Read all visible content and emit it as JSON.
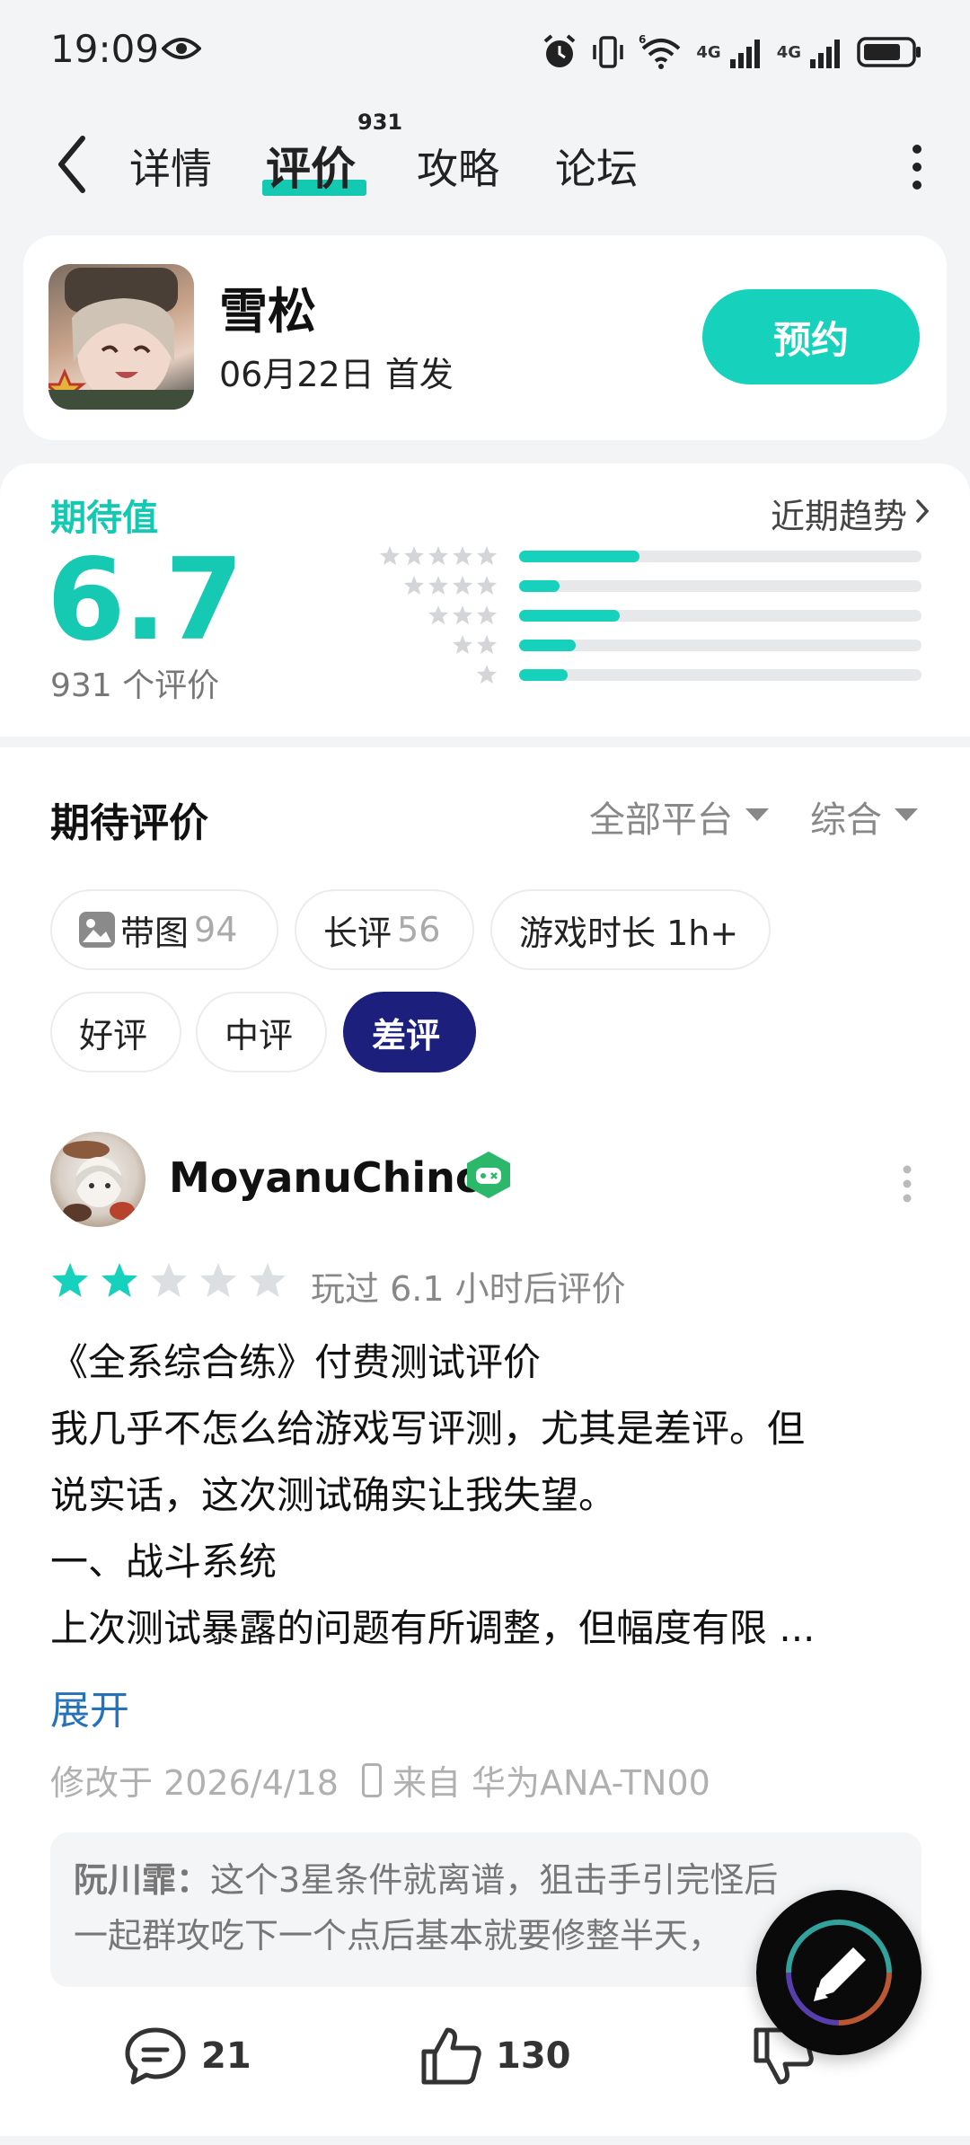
{
  "status_bar": {
    "time": "19:09",
    "net1": "4G",
    "net2": "4G",
    "wifi_badge": "6"
  },
  "nav": {
    "tabs": [
      {
        "label": "详情"
      },
      {
        "label": "评价",
        "badge": "931"
      },
      {
        "label": "攻略"
      },
      {
        "label": "论坛"
      }
    ],
    "active_tab": "评价"
  },
  "game": {
    "name": "雪松",
    "release": "06月22日 首发",
    "action_label": "预约",
    "accent_color": "#16d1bb"
  },
  "rating": {
    "label": "期待值",
    "score": "6.7",
    "count_text": "931 个评价",
    "trend_label": "近期趋势",
    "distribution": [
      {
        "stars": 5,
        "fraction": 0.3
      },
      {
        "stars": 4,
        "fraction": 0.1
      },
      {
        "stars": 3,
        "fraction": 0.25
      },
      {
        "stars": 2,
        "fraction": 0.14
      },
      {
        "stars": 1,
        "fraction": 0.12
      }
    ]
  },
  "reviews": {
    "title": "期待评价",
    "filters": {
      "platform": "全部平台",
      "sort": "综合"
    },
    "chips": [
      {
        "label": "带图",
        "count": "94"
      },
      {
        "label": "长评",
        "count": "56"
      },
      {
        "label": "游戏时长 1h+"
      },
      {
        "label": "好评"
      },
      {
        "label": "中评"
      },
      {
        "label": "差评"
      }
    ],
    "active_chip": "差评",
    "item": {
      "username": "MoyanuChino",
      "rating": 2,
      "play_time": "玩过 6.1 小时后评价",
      "text_lines": [
        "《全系综合练》付费测试评价",
        "我几乎不怎么给游戏写评测，尤其是差评。但",
        "说实话，这次测试确实让我失望。",
        "一、战斗系统",
        "上次测试暴露的问题有所调整，但幅度有限 ..."
      ],
      "expand_label": "展开",
      "modified": "修改于 2026/4/18",
      "device": "来自 华为ANA-TN00",
      "reply": {
        "name": "阮川霏：",
        "lines": [
          "这个3星条件就离谱，狙击手引完怪后",
          "一起群攻吃下一个点后基本就要修整半天，"
        ]
      },
      "comments": "21",
      "likes": "130"
    }
  }
}
